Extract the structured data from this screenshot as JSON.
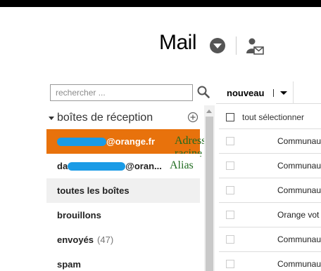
{
  "header": {
    "title": "Mail",
    "icons": {
      "menu": "chevron-down-circle-icon",
      "contacts": "contacts-mail-icon"
    }
  },
  "search": {
    "placeholder": "rechercher ...",
    "value": ""
  },
  "toolbar": {
    "new_label": "nouveau"
  },
  "folders": {
    "title": "boîtes de réception",
    "items": [
      {
        "prefix": "",
        "label": "@orange.fr",
        "annotation": "Adresse racine",
        "selected": true
      },
      {
        "prefix": "da",
        "label": "@oran...",
        "annotation": "Alias"
      },
      {
        "label": "toutes les boîtes"
      },
      {
        "label": "brouillons"
      },
      {
        "label": "envoyés",
        "count": "(47)"
      },
      {
        "label": "spam"
      }
    ]
  },
  "mail_list": {
    "select_all": "tout sélectionner",
    "rows": [
      {
        "sender": "Communau"
      },
      {
        "sender": "Communau"
      },
      {
        "sender": "Communau"
      },
      {
        "sender": "Orange vot"
      },
      {
        "sender": "Communau"
      },
      {
        "sender": "Communau"
      }
    ]
  },
  "colors": {
    "accent": "#e8720c",
    "annotation": "#1f6b1f",
    "redaction": "#1a9be6"
  }
}
